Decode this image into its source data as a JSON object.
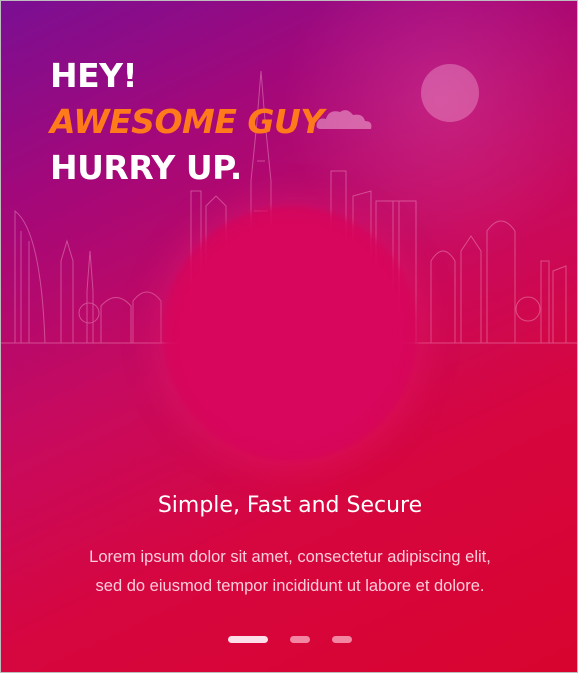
{
  "headline": {
    "line1": "HEY!",
    "line2": "AWESOME GUY",
    "line3": "HURRY UP."
  },
  "content": {
    "title": "Simple, Fast and Secure",
    "body_line1": "Lorem ipsum dolor sit amet, consectetur adipiscing elit,",
    "body_line2": "sed do eiusmod tempor incididunt ut labore et dolore."
  },
  "pager": {
    "total_pages": 3,
    "current_page": 1
  },
  "colors": {
    "accent": "#ff7a1a",
    "gradient_start": "#7a0f93",
    "gradient_end": "#d8042f",
    "text": "#ffffff"
  },
  "icons": {
    "sun": "sun-icon",
    "cloud": "cloud-icon"
  }
}
